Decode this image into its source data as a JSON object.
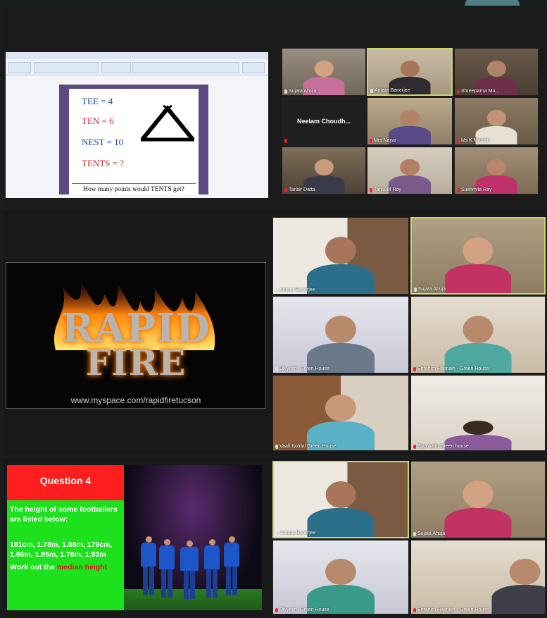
{
  "slide1": {
    "equations": [
      {
        "text": "TEE  =  4",
        "color": "#1f3fb4"
      },
      {
        "text": "TEN  =  6",
        "color": "#d0202a"
      },
      {
        "text": "NEST  =  10",
        "color": "#1f3fb4"
      },
      {
        "text": "TENTS  =  ?",
        "color": "#d0202a"
      }
    ],
    "question": "How many points would TENTS get?"
  },
  "gallery1": [
    {
      "name": "Sujata Ahuja",
      "mic": "on"
    },
    {
      "name": "Antara Banerjee",
      "mic": "on"
    },
    {
      "name": "Shreeparna Mu...",
      "mic": "off"
    },
    {
      "name": "Neelam  Choudh...",
      "mic": "off",
      "video_off": true
    },
    {
      "name": "Mrs Nayar",
      "mic": "off"
    },
    {
      "name": "Ms K Manish",
      "mic": "off"
    },
    {
      "name": "Tanbir Datta",
      "mic": "off"
    },
    {
      "name": "Tania M Roy",
      "mic": "off"
    },
    {
      "name": "Sushmita Ray",
      "mic": "off"
    }
  ],
  "slide2": {
    "title_line1": "RAPID",
    "title_line2": "FIRE",
    "url": "www.myspace.com/rapidfiretucson"
  },
  "gallery2": [
    {
      "name": "Antara Banerjee",
      "mic": "on"
    },
    {
      "name": "Sujata Ahuja",
      "mic": "on"
    },
    {
      "name": "Divyesh- Green House",
      "mic": "on"
    },
    {
      "name": "Ebrahim Hasnain - Green House",
      "mic": "off"
    },
    {
      "name": "Vaafi Kotdal Green House",
      "mic": "on"
    },
    {
      "name": "Ziya Azim Green house",
      "mic": "off"
    }
  ],
  "slide3": {
    "heading": "Question 4",
    "intro": "The height of some footballers are listed below:",
    "values": "181cm, 1.78m, 1.88m, 179cm, 1.86m, 1.85m, 1.78m, 1.93m",
    "task_prefix": "Work out the ",
    "task_highlight": "median height"
  },
  "gallery3": [
    {
      "name": "Antara Banerjee",
      "mic": "on"
    },
    {
      "name": "Sujata Ahuja",
      "mic": "on"
    },
    {
      "name": "Divyesh- Green House",
      "mic": "off"
    },
    {
      "name": "Ebrahim Hasnain - Green House",
      "mic": "off"
    }
  ]
}
